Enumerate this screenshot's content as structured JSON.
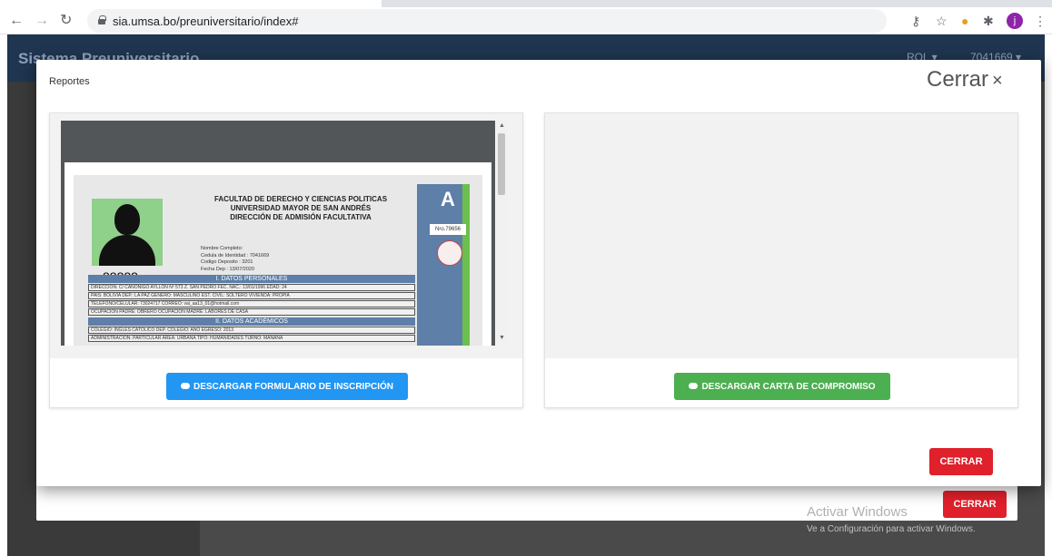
{
  "browser": {
    "url": "sia.umsa.bo/preuniversitario/index#",
    "avatar_letter": "j"
  },
  "app": {
    "brand": "Sistema Preuniversitario",
    "rol_label": "ROL ▾",
    "user_label": "7041669 ▾"
  },
  "backdrop": {
    "close_label": "CERRAR",
    "watermark_title": "Activar Windows",
    "watermark_sub": "Ve a Configuración para activar Windows."
  },
  "modal": {
    "title": "Reportes",
    "close_text": "Cerrar",
    "close_x": "×",
    "footer_close_label": "CERRAR",
    "left_card": {
      "button_label": "DESCARGAR FORMULARIO DE INSCRIPCIÓN",
      "document": {
        "faculty": "FACULTAD DE DERECHO Y CIENCIAS POLITICAS",
        "university": "UNIVERSIDAD MAYOR DE SAN ANDRÉS",
        "direction": "DIRECCIÓN DE ADMISIÓN FACULTATIVA",
        "photo_number": "88888",
        "letter": "A",
        "nro": "Nro.79656",
        "field_name": "Nombre Completo:",
        "field_ci": "Cedula de Identidad : 7041669",
        "field_deposit": "Codigo Deposito : 3201",
        "field_date": "Fecha Dep : 13/07/2020",
        "section_personal": "I. DATOS PERSONALES",
        "row1": "DIRECCION:   C/ CANONIGO AYLLON Nº 573 Z. SAN PEDRO        FEC. NAC.:   13/01/1996    EDAD:  24",
        "row2": "PAIS:  BOLIVIA        DEP.: LA PAZ        GENERO: MASCULINO      EST. CIVIL: SOLTERO      VIVIENDA: PROPIA",
        "row3": "TELEFONO/CELULAR:  73024717           CORREO:    vai_aa13_01@hotmail.com",
        "row4": "OCUPACION PADRE:   OBRERO             OCUPACION MADRE:      LABORES DE CASA",
        "section_academic": "II. DATOS ACADÉMICOS",
        "row5": "COLEGIO:   INGLES CATOLICO              DEP. COLEGIO:              AÑO EGRESO:   2013",
        "row6": "ADMINISTRACION:  PARTICULAR          AREA: URBANA       TIPO: HUMANIDADES      TURNO: MAÑANA"
      }
    },
    "right_card": {
      "button_label": "DESCARGAR CARTA DE COMPROMISO"
    }
  }
}
